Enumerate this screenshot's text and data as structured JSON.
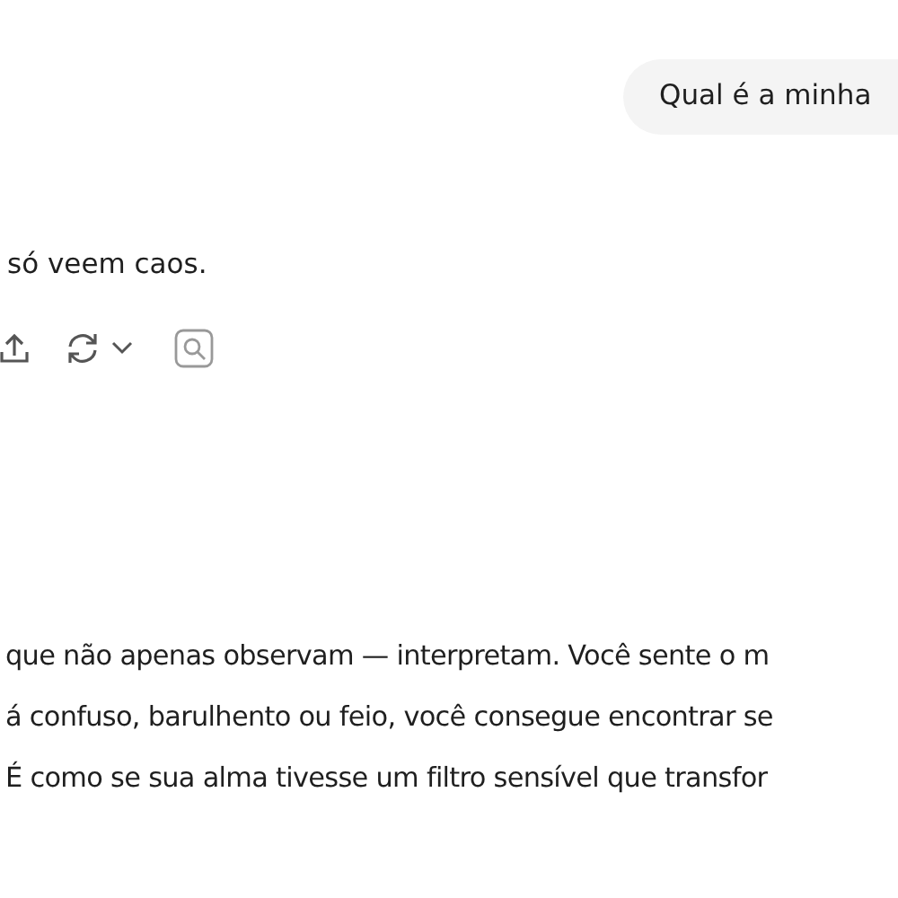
{
  "user_message": {
    "text": "Qual é a minha"
  },
  "reply_top": {
    "text": "só veem caos."
  },
  "reply_bottom": {
    "lines": [
      "que não apenas observam — interpretam. Você sente o m",
      "á confuso, barulhento ou feio, você consegue encontrar se",
      "É como se sua alma tivesse um filtro sensível que transfor"
    ]
  }
}
